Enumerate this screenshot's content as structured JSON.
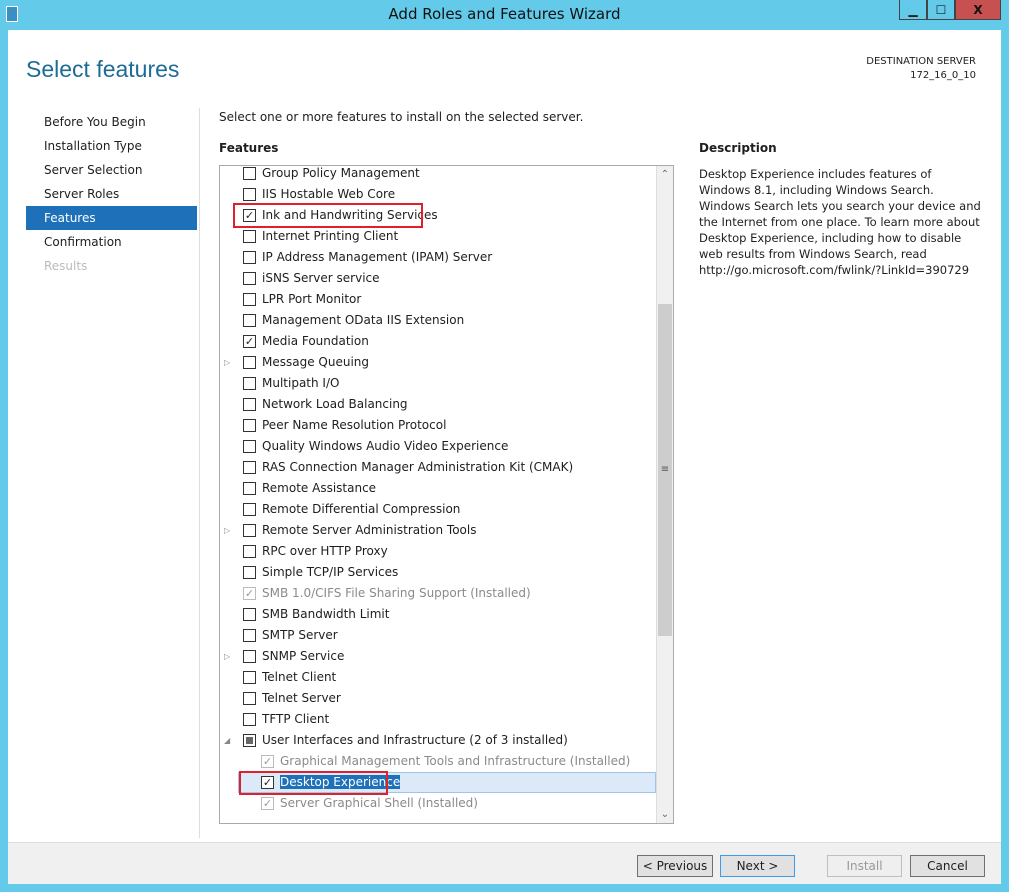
{
  "window": {
    "title": "Add Roles and Features Wizard",
    "minimize": "▁",
    "maximize": "☐",
    "close": "X"
  },
  "header": {
    "page_title": "Select features",
    "dest_label": "DESTINATION SERVER",
    "dest_server": "172_16_0_10"
  },
  "nav": [
    {
      "label": "Before You Begin",
      "state": "normal"
    },
    {
      "label": "Installation Type",
      "state": "normal"
    },
    {
      "label": "Server Selection",
      "state": "normal"
    },
    {
      "label": "Server Roles",
      "state": "normal"
    },
    {
      "label": "Features",
      "state": "active"
    },
    {
      "label": "Confirmation",
      "state": "normal"
    },
    {
      "label": "Results",
      "state": "disabled"
    }
  ],
  "main": {
    "instruction": "Select one or more features to install on the selected server.",
    "features_label": "Features",
    "features": [
      {
        "label": "Group Policy Management",
        "checked": false
      },
      {
        "label": "IIS Hostable Web Core",
        "checked": false
      },
      {
        "label": "Ink and Handwriting Services",
        "checked": true,
        "highlighted": true
      },
      {
        "label": "Internet Printing Client",
        "checked": false
      },
      {
        "label": "IP Address Management (IPAM) Server",
        "checked": false
      },
      {
        "label": "iSNS Server service",
        "checked": false
      },
      {
        "label": "LPR Port Monitor",
        "checked": false
      },
      {
        "label": "Management OData IIS Extension",
        "checked": false
      },
      {
        "label": "Media Foundation",
        "checked": true
      },
      {
        "label": "Message Queuing",
        "checked": false,
        "expander": "collapsed"
      },
      {
        "label": "Multipath I/O",
        "checked": false
      },
      {
        "label": "Network Load Balancing",
        "checked": false
      },
      {
        "label": "Peer Name Resolution Protocol",
        "checked": false
      },
      {
        "label": "Quality Windows Audio Video Experience",
        "checked": false
      },
      {
        "label": "RAS Connection Manager Administration Kit (CMAK)",
        "checked": false
      },
      {
        "label": "Remote Assistance",
        "checked": false
      },
      {
        "label": "Remote Differential Compression",
        "checked": false
      },
      {
        "label": "Remote Server Administration Tools",
        "checked": false,
        "expander": "collapsed"
      },
      {
        "label": "RPC over HTTP Proxy",
        "checked": false
      },
      {
        "label": "Simple TCP/IP Services",
        "checked": false
      },
      {
        "label": "SMB 1.0/CIFS File Sharing Support (Installed)",
        "checked": true,
        "disabled": true
      },
      {
        "label": "SMB Bandwidth Limit",
        "checked": false
      },
      {
        "label": "SMTP Server",
        "checked": false
      },
      {
        "label": "SNMP Service",
        "checked": false,
        "expander": "collapsed"
      },
      {
        "label": "Telnet Client",
        "checked": false
      },
      {
        "label": "Telnet Server",
        "checked": false
      },
      {
        "label": "TFTP Client",
        "checked": false
      },
      {
        "label": "User Interfaces and Infrastructure (2 of 3 installed)",
        "checked": "partial",
        "expander": "expanded"
      },
      {
        "label": "Graphical Management Tools and Infrastructure (Installed)",
        "checked": true,
        "disabled": true,
        "child": true
      },
      {
        "label": "Desktop Experience",
        "checked": true,
        "child": true,
        "selected": true,
        "highlighted": true
      },
      {
        "label": "Server Graphical Shell (Installed)",
        "checked": true,
        "disabled": true,
        "child": true
      }
    ]
  },
  "description": {
    "heading": "Description",
    "text": "Desktop Experience includes features of Windows 8.1, including Windows Search. Windows Search lets you search your device and the Internet from one place. To learn more about Desktop Experience, including how to disable web results from Windows Search, read http://go.microsoft.com/fwlink/?LinkId=390729"
  },
  "footer": {
    "previous": "< Previous",
    "next": "Next >",
    "install": "Install",
    "cancel": "Cancel"
  },
  "colors": {
    "titlebar": "#63caea",
    "accent": "#1e71b8",
    "highlight_box": "#e0202a"
  }
}
